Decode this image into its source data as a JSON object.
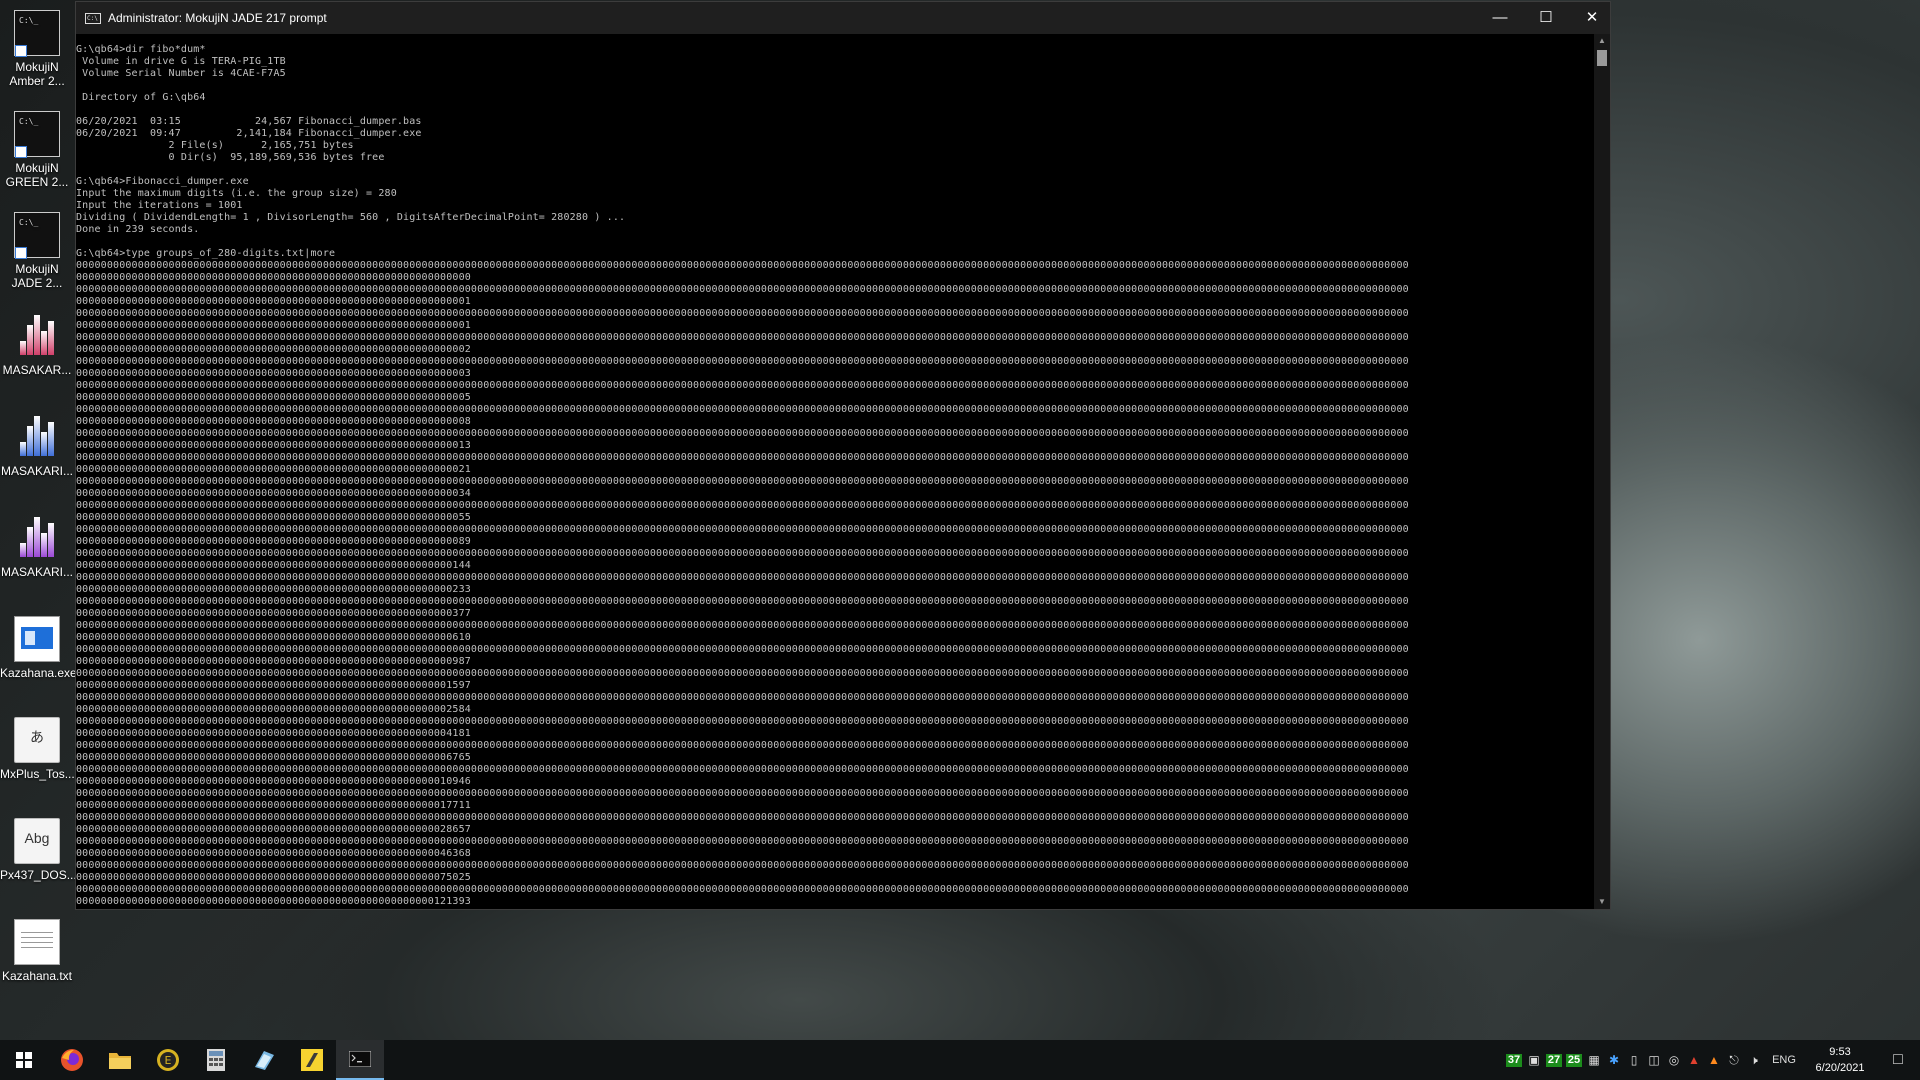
{
  "window": {
    "title": "Administrator: MokujiN JADE 217 prompt",
    "console_lines": [
      "G:\\qb64>dir fibo*dum*",
      " Volume in drive G is TERA-PIG_1TB",
      " Volume Serial Number is 4CAE-F7A5",
      "",
      " Directory of G:\\qb64",
      "",
      "06/20/2021  03:15            24,567 Fibonacci_dumper.bas",
      "06/20/2021  09:47         2,141,184 Fibonacci_dumper.exe",
      "               2 File(s)      2,165,751 bytes",
      "               0 Dir(s)  95,189,569,536 bytes free",
      "",
      "G:\\qb64>Fibonacci_dumper.exe",
      "Input the maximum digits (i.e. the group size) = 280",
      "Input the iterations = 1001",
      "Dividing ( DividendLength= 1 , DivisorLength= 560 , DigitsAfterDecimalPoint= 280280 ) ...",
      "Done in 239 seconds.",
      "",
      "G:\\qb64>type groups_of_280-digits.txt|more"
    ],
    "fibonacci_tails": [
      "0",
      "1",
      "1",
      "2",
      "3",
      "5",
      "8",
      "13",
      "21",
      "34",
      "55",
      "89",
      "144",
      "233",
      "377",
      "610",
      "987",
      "1597",
      "2584",
      "4181",
      "6765",
      "10946",
      "17711",
      "28657",
      "46368",
      "75025",
      "121393"
    ]
  },
  "desktop_icons": [
    {
      "label": "MokujiN Amber 2...",
      "type": "cmd"
    },
    {
      "label": "MokujiN GREEN 2...",
      "type": "cmd"
    },
    {
      "label": "MokujiN JADE 2...",
      "type": "cmd"
    },
    {
      "label": "MASAKAR...",
      "type": "bars",
      "color": "#d0406a"
    },
    {
      "label": "MASAKARI...",
      "type": "bars",
      "color": "#3f6fd8"
    },
    {
      "label": "MASAKARI...",
      "type": "bars",
      "color": "#9b49d6"
    },
    {
      "label": "Kazahana.exe",
      "type": "exe"
    },
    {
      "label": "MxPlus_Tos...",
      "type": "doc",
      "glyph": "あ"
    },
    {
      "label": "Px437_DOS...",
      "type": "doc",
      "glyph": "Abg"
    },
    {
      "label": "Kazahana.txt",
      "type": "txt"
    }
  ],
  "tray": {
    "badges": [
      "37",
      "27",
      "25"
    ],
    "language": "ENG",
    "time": "9:53",
    "date": "6/20/2021"
  }
}
